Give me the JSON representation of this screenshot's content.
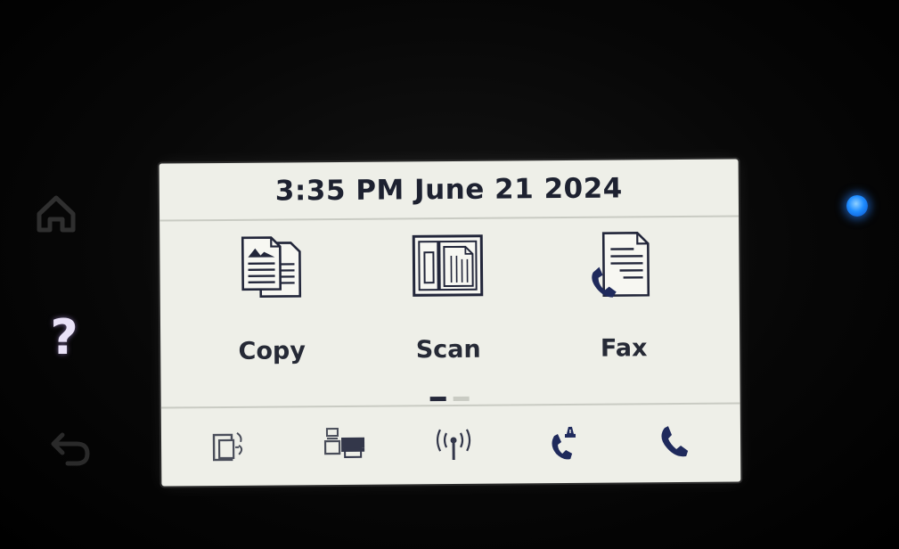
{
  "header": {
    "datetime": "3:35 PM June 21 2024"
  },
  "apps": [
    {
      "label": "Copy",
      "icon": "copy-icon"
    },
    {
      "label": "Scan",
      "icon": "scan-icon"
    },
    {
      "label": "Fax",
      "icon": "fax-icon"
    }
  ],
  "pager": {
    "pages": 2,
    "current": 1
  },
  "tray": [
    {
      "icon": "wifi-direct-icon"
    },
    {
      "icon": "print-queue-icon"
    },
    {
      "icon": "wireless-icon"
    },
    {
      "icon": "fax-status-icon"
    },
    {
      "icon": "phone-icon"
    }
  ],
  "bezel": {
    "help_glyph": "?",
    "status_light_color": "#1e8cff"
  },
  "colors": {
    "screen_bg": "#eeefe8",
    "screen_text": "#1d2130",
    "fax_icon_accent": "#1f2a5c"
  }
}
